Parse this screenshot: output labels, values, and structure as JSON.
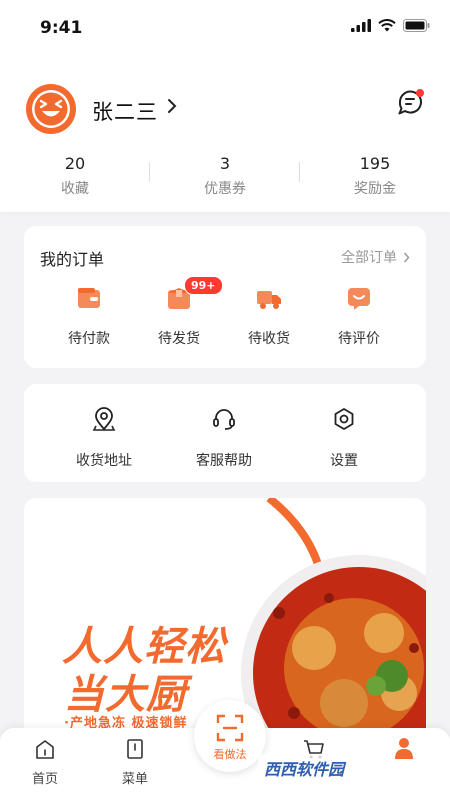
{
  "status_bar": {
    "time": "9:41"
  },
  "colors": {
    "accent": "#f26a2e",
    "badge": "#ff3a2f",
    "background": "#f3f3f5"
  },
  "profile": {
    "name": "张二三",
    "stats": [
      {
        "value": "20",
        "label": "收藏"
      },
      {
        "value": "3",
        "label": "优惠券"
      },
      {
        "value": "195",
        "label": "奖励金"
      }
    ]
  },
  "orders": {
    "title": "我的订单",
    "all_label": "全部订单",
    "items": [
      {
        "label": "待付款",
        "icon": "wallet-icon"
      },
      {
        "label": "待发货",
        "icon": "package-icon",
        "badge": "99+"
      },
      {
        "label": "待收货",
        "icon": "truck-icon"
      },
      {
        "label": "待评价",
        "icon": "comment-icon"
      }
    ]
  },
  "services": {
    "items": [
      {
        "label": "收货地址",
        "icon": "location-pin-icon"
      },
      {
        "label": "客服帮助",
        "icon": "headset-icon"
      },
      {
        "label": "设置",
        "icon": "gear-icon"
      }
    ]
  },
  "banner": {
    "line1": "人人轻松",
    "line2": "当大厨",
    "subtitle": "·产地急冻 极速锁鲜"
  },
  "tab_bar": {
    "tabs": [
      {
        "label": "首页",
        "icon": "home-icon"
      },
      {
        "label": "菜单",
        "icon": "menu-book-icon"
      }
    ],
    "center_label": "看做法"
  },
  "watermark": "西西软件园"
}
